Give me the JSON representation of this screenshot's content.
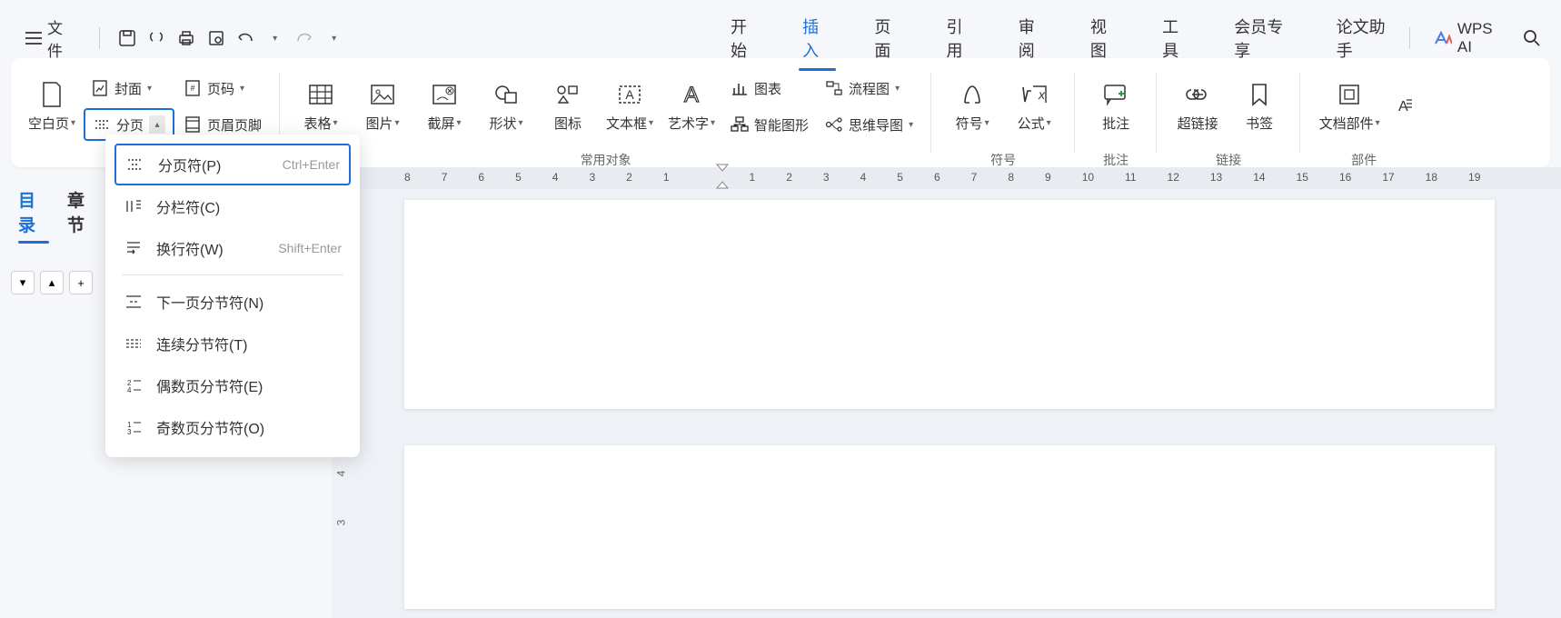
{
  "menubar": {
    "file": "文件",
    "tabs": [
      "开始",
      "插入",
      "页面",
      "引用",
      "审阅",
      "视图",
      "工具",
      "会员专享",
      "论文助手"
    ],
    "active_tab": "插入",
    "wps_ai": "WPS AI"
  },
  "ribbon": {
    "blank_page": "空白页",
    "cover": "封面",
    "page_number": "页码",
    "page_break": "分页",
    "header_footer": "页眉页脚",
    "table": "表格",
    "picture": "图片",
    "screenshot": "截屏",
    "shape": "形状",
    "icon": "图标",
    "textbox": "文本框",
    "wordart": "艺术字",
    "chart": "图表",
    "smartart": "智能图形",
    "flowchart": "流程图",
    "mindmap": "思维导图",
    "symbol": "符号",
    "equation": "公式",
    "comment": "批注",
    "hyperlink": "超链接",
    "bookmark": "书签",
    "doc_parts": "文档部件",
    "group_common": "常用对象",
    "group_symbol": "符号",
    "group_comment": "批注",
    "group_link": "链接",
    "group_parts": "部件"
  },
  "dropdown": {
    "items": [
      {
        "label": "分页符(P)",
        "shortcut": "Ctrl+Enter"
      },
      {
        "label": "分栏符(C)",
        "shortcut": ""
      },
      {
        "label": "换行符(W)",
        "shortcut": "Shift+Enter"
      },
      {
        "label": "下一页分节符(N)",
        "shortcut": ""
      },
      {
        "label": "连续分节符(T)",
        "shortcut": ""
      },
      {
        "label": "偶数页分节符(E)",
        "shortcut": ""
      },
      {
        "label": "奇数页分节符(O)",
        "shortcut": ""
      }
    ]
  },
  "leftpanel": {
    "tabs": [
      "目录",
      "章节"
    ],
    "active": "目录"
  },
  "ruler": {
    "left": [
      "8",
      "7",
      "6",
      "5",
      "4",
      "3",
      "2",
      "1"
    ],
    "right": [
      "1",
      "2",
      "3",
      "4",
      "5",
      "6",
      "7",
      "8",
      "9",
      "10",
      "11",
      "12",
      "13",
      "14",
      "15",
      "16",
      "17",
      "18",
      "19"
    ]
  },
  "v_ruler": [
    "4",
    "3"
  ]
}
